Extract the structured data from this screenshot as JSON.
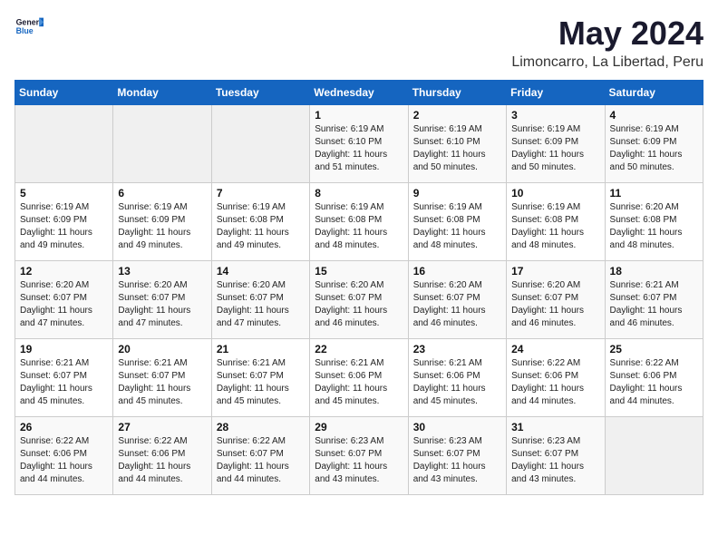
{
  "header": {
    "logo_general": "General",
    "logo_blue": "Blue",
    "month": "May 2024",
    "location": "Limoncarro, La Libertad, Peru"
  },
  "days_of_week": [
    "Sunday",
    "Monday",
    "Tuesday",
    "Wednesday",
    "Thursday",
    "Friday",
    "Saturday"
  ],
  "weeks": [
    [
      {
        "day": "",
        "info": ""
      },
      {
        "day": "",
        "info": ""
      },
      {
        "day": "",
        "info": ""
      },
      {
        "day": "1",
        "info": "Sunrise: 6:19 AM\nSunset: 6:10 PM\nDaylight: 11 hours\nand 51 minutes."
      },
      {
        "day": "2",
        "info": "Sunrise: 6:19 AM\nSunset: 6:10 PM\nDaylight: 11 hours\nand 50 minutes."
      },
      {
        "day": "3",
        "info": "Sunrise: 6:19 AM\nSunset: 6:09 PM\nDaylight: 11 hours\nand 50 minutes."
      },
      {
        "day": "4",
        "info": "Sunrise: 6:19 AM\nSunset: 6:09 PM\nDaylight: 11 hours\nand 50 minutes."
      }
    ],
    [
      {
        "day": "5",
        "info": "Sunrise: 6:19 AM\nSunset: 6:09 PM\nDaylight: 11 hours\nand 49 minutes."
      },
      {
        "day": "6",
        "info": "Sunrise: 6:19 AM\nSunset: 6:09 PM\nDaylight: 11 hours\nand 49 minutes."
      },
      {
        "day": "7",
        "info": "Sunrise: 6:19 AM\nSunset: 6:08 PM\nDaylight: 11 hours\nand 49 minutes."
      },
      {
        "day": "8",
        "info": "Sunrise: 6:19 AM\nSunset: 6:08 PM\nDaylight: 11 hours\nand 48 minutes."
      },
      {
        "day": "9",
        "info": "Sunrise: 6:19 AM\nSunset: 6:08 PM\nDaylight: 11 hours\nand 48 minutes."
      },
      {
        "day": "10",
        "info": "Sunrise: 6:19 AM\nSunset: 6:08 PM\nDaylight: 11 hours\nand 48 minutes."
      },
      {
        "day": "11",
        "info": "Sunrise: 6:20 AM\nSunset: 6:08 PM\nDaylight: 11 hours\nand 48 minutes."
      }
    ],
    [
      {
        "day": "12",
        "info": "Sunrise: 6:20 AM\nSunset: 6:07 PM\nDaylight: 11 hours\nand 47 minutes."
      },
      {
        "day": "13",
        "info": "Sunrise: 6:20 AM\nSunset: 6:07 PM\nDaylight: 11 hours\nand 47 minutes."
      },
      {
        "day": "14",
        "info": "Sunrise: 6:20 AM\nSunset: 6:07 PM\nDaylight: 11 hours\nand 47 minutes."
      },
      {
        "day": "15",
        "info": "Sunrise: 6:20 AM\nSunset: 6:07 PM\nDaylight: 11 hours\nand 46 minutes."
      },
      {
        "day": "16",
        "info": "Sunrise: 6:20 AM\nSunset: 6:07 PM\nDaylight: 11 hours\nand 46 minutes."
      },
      {
        "day": "17",
        "info": "Sunrise: 6:20 AM\nSunset: 6:07 PM\nDaylight: 11 hours\nand 46 minutes."
      },
      {
        "day": "18",
        "info": "Sunrise: 6:21 AM\nSunset: 6:07 PM\nDaylight: 11 hours\nand 46 minutes."
      }
    ],
    [
      {
        "day": "19",
        "info": "Sunrise: 6:21 AM\nSunset: 6:07 PM\nDaylight: 11 hours\nand 45 minutes."
      },
      {
        "day": "20",
        "info": "Sunrise: 6:21 AM\nSunset: 6:07 PM\nDaylight: 11 hours\nand 45 minutes."
      },
      {
        "day": "21",
        "info": "Sunrise: 6:21 AM\nSunset: 6:07 PM\nDaylight: 11 hours\nand 45 minutes."
      },
      {
        "day": "22",
        "info": "Sunrise: 6:21 AM\nSunset: 6:06 PM\nDaylight: 11 hours\nand 45 minutes."
      },
      {
        "day": "23",
        "info": "Sunrise: 6:21 AM\nSunset: 6:06 PM\nDaylight: 11 hours\nand 45 minutes."
      },
      {
        "day": "24",
        "info": "Sunrise: 6:22 AM\nSunset: 6:06 PM\nDaylight: 11 hours\nand 44 minutes."
      },
      {
        "day": "25",
        "info": "Sunrise: 6:22 AM\nSunset: 6:06 PM\nDaylight: 11 hours\nand 44 minutes."
      }
    ],
    [
      {
        "day": "26",
        "info": "Sunrise: 6:22 AM\nSunset: 6:06 PM\nDaylight: 11 hours\nand 44 minutes."
      },
      {
        "day": "27",
        "info": "Sunrise: 6:22 AM\nSunset: 6:06 PM\nDaylight: 11 hours\nand 44 minutes."
      },
      {
        "day": "28",
        "info": "Sunrise: 6:22 AM\nSunset: 6:07 PM\nDaylight: 11 hours\nand 44 minutes."
      },
      {
        "day": "29",
        "info": "Sunrise: 6:23 AM\nSunset: 6:07 PM\nDaylight: 11 hours\nand 43 minutes."
      },
      {
        "day": "30",
        "info": "Sunrise: 6:23 AM\nSunset: 6:07 PM\nDaylight: 11 hours\nand 43 minutes."
      },
      {
        "day": "31",
        "info": "Sunrise: 6:23 AM\nSunset: 6:07 PM\nDaylight: 11 hours\nand 43 minutes."
      },
      {
        "day": "",
        "info": ""
      }
    ]
  ]
}
